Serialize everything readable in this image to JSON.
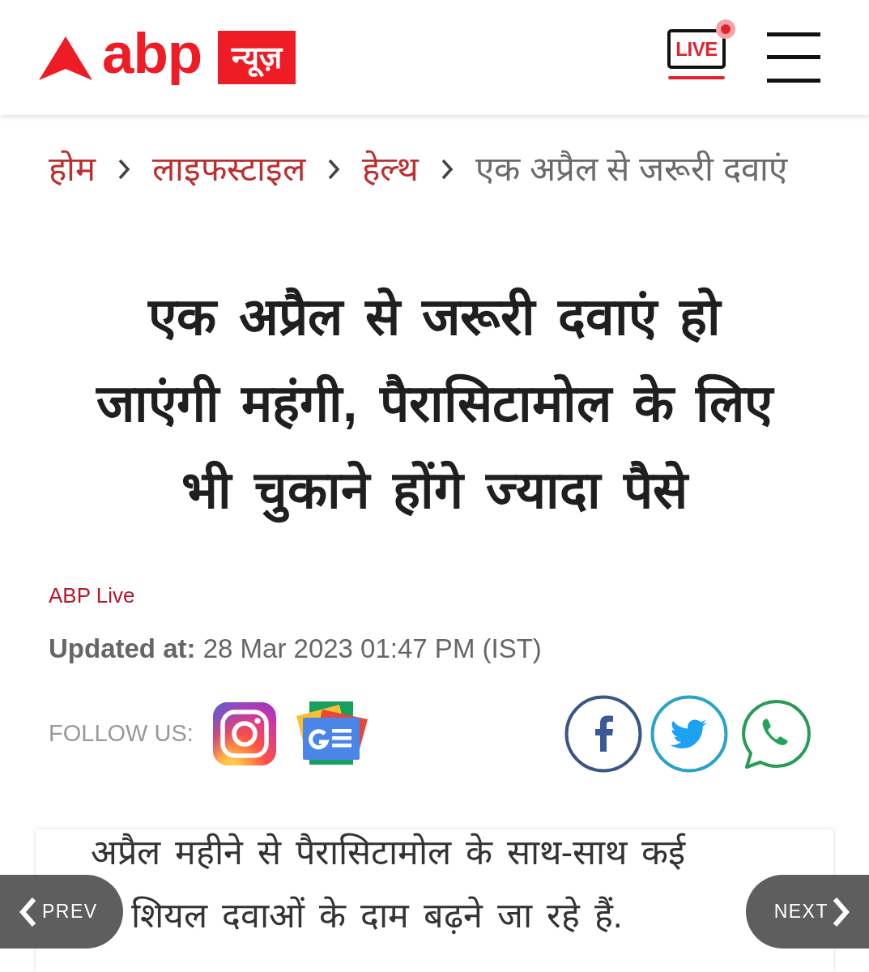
{
  "header": {
    "logo_text": "abp",
    "logo_badge": "न्यूज़",
    "live_label": "LIVE"
  },
  "breadcrumb": [
    {
      "label": "होम",
      "current": false
    },
    {
      "label": "लाइफस्टाइल",
      "current": false
    },
    {
      "label": "हेल्थ",
      "current": false
    },
    {
      "label": "एक अप्रैल से जरूरी दवाएं",
      "current": true
    }
  ],
  "headline": "एक अप्रैल से जरूरी दवाएं हो जाएंगी महंगी, पैरासिटामोल के लिए भी चुकाने होंगे ज्यादा पैसे",
  "byline": {
    "source": "ABP Live",
    "updated": "**Updated at:** 28 Mar 2023 01:47 PM (IST)"
  },
  "follow": {
    "label": "FOLLOW US:",
    "channels": [
      {
        "kind": "instagram"
      },
      {
        "kind": "google-news"
      }
    ]
  },
  "share": [
    {
      "kind": "facebook"
    },
    {
      "kind": "twitter"
    },
    {
      "kind": "whatsapp"
    }
  ],
  "summary": {
    "lines": [
      "अप्रैल महीने से पैरासिटामोल के साथ-साथ कई",
      "शियल दवाओं के दाम बढ़ने जा रहे हैं."
    ]
  },
  "pager": {
    "prev": "PREV",
    "next": "NEXT"
  }
}
